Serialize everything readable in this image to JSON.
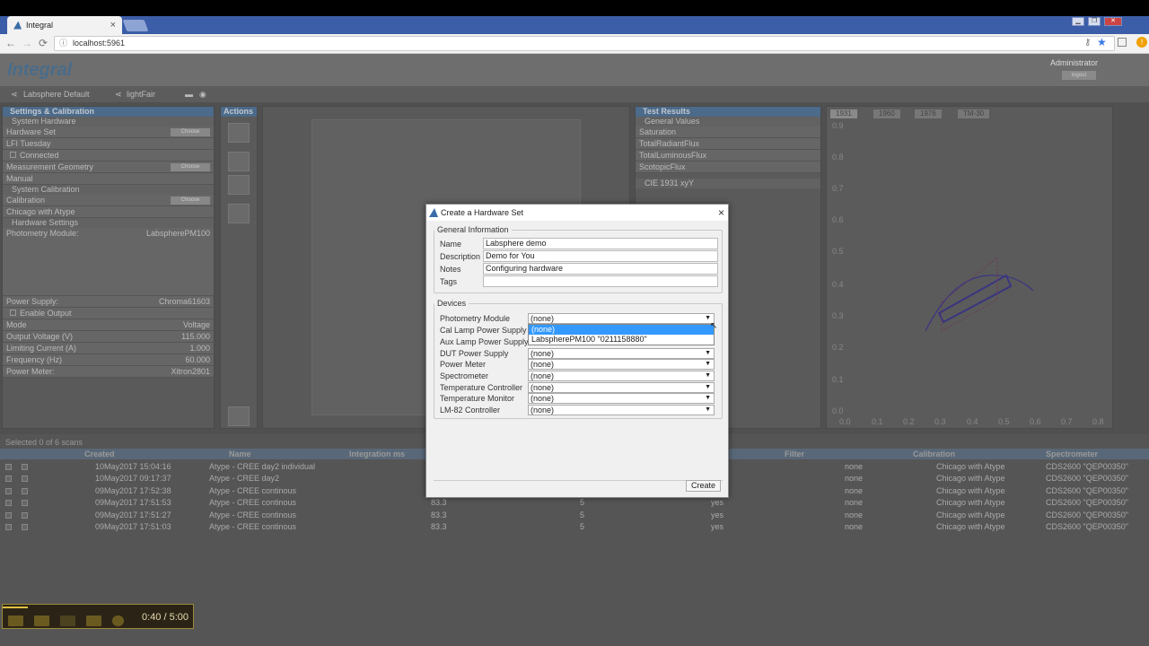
{
  "browser": {
    "tab_title": "Integral",
    "tab_close": "×",
    "url": "localhost:5961",
    "back_glyph": "←",
    "forward_glyph": "→",
    "reload_glyph": "⟳",
    "info_glyph": "ⓘ",
    "win_minimize": "▁",
    "win_restore": "❐",
    "win_close": "✕"
  },
  "app": {
    "logo": "Integral",
    "user": "Administrator",
    "logout": "logout"
  },
  "crumbs": {
    "profile": "Labsphere Default",
    "project": "lightFair"
  },
  "left": {
    "header": "Settings & Calibration",
    "system_hardware": "System Hardware",
    "hardware_set_label": "Hardware Set",
    "choose": "Choose",
    "hardware_set_value": "LFI Tuesday",
    "connected": "Connected",
    "measurement_geometry": "Measurement Geometry",
    "geometry_value": "Manual",
    "system_calibration": "System Calibration",
    "calibration_label": "Calibration",
    "calibration_value": "Chicago with Atype",
    "hardware_settings": "Hardware Settings",
    "photometry_module_label": "Photometry Module:",
    "photometry_module_value": "LabspherePM100",
    "power_supply_label": "Power Supply:",
    "power_supply_value": "Chroma61603",
    "enable_output": "Enable Output",
    "mode_label": "Mode",
    "mode_value": "Voltage",
    "output_voltage_label": "Output Voltage (V)",
    "output_voltage_value": "115.000",
    "limiting_current_label": "Limiting Current (A)",
    "limiting_current_value": "1.000",
    "frequency_label": "Frequency (Hz)",
    "frequency_value": "60.000",
    "power_meter_label": "Power Meter:",
    "power_meter_value": "Xitron2801"
  },
  "actions": {
    "header": "Actions"
  },
  "test_results": {
    "header": "Test Results",
    "general_values": "General Values",
    "items": [
      "Saturation",
      "TotalRadiantFlux",
      "TotalLuminousFlux",
      "ScotopicFlux"
    ],
    "cie": "CIE 1931 xyY"
  },
  "chart": {
    "tabs": [
      "1931",
      "1960",
      "1976",
      "TM-30"
    ],
    "yticks": [
      "0.9",
      "0.8",
      "0.7",
      "0.6",
      "0.5",
      "0.4",
      "0.3",
      "0.2",
      "0.1",
      "0.0"
    ],
    "xticks": [
      "0.0",
      "0.1",
      "0.2",
      "0.3",
      "0.4",
      "0.5",
      "0.6",
      "0.7",
      "0.8"
    ]
  },
  "table": {
    "selected": "Selected 0 of 6 scans",
    "headers": {
      "created": "Created",
      "name": "Name",
      "integration": "Integration ms",
      "filter": "Filter",
      "calibration": "Calibration",
      "spectrometer": "Spectrometer"
    },
    "rows": [
      {
        "created": "10May2017 15:04:16",
        "name": "Atype - CREE day2 individual",
        "int": "",
        "avg": "",
        "filt": "",
        "filter": "none",
        "cal": "Chicago with Atype",
        "spec": "CDS2600 \"QEP00350\""
      },
      {
        "created": "10May2017 09:17:37",
        "name": "Atype - CREE day2",
        "int": "",
        "avg": "",
        "filt": "",
        "filter": "none",
        "cal": "Chicago with Atype",
        "spec": "CDS2600 \"QEP00350\""
      },
      {
        "created": "09May2017 17:52:38",
        "name": "Atype - CREE continous",
        "int": "",
        "avg": "",
        "filt": "",
        "filter": "none",
        "cal": "Chicago with Atype",
        "spec": "CDS2600 \"QEP00350\""
      },
      {
        "created": "09May2017 17:51:53",
        "name": "Atype - CREE continous",
        "int": "83.3",
        "avg": "5",
        "filt": "yes",
        "filter": "none",
        "cal": "Chicago with Atype",
        "spec": "CDS2600 \"QEP00350\""
      },
      {
        "created": "09May2017 17:51:27",
        "name": "Atype - CREE continous",
        "int": "83.3",
        "avg": "5",
        "filt": "yes",
        "filter": "none",
        "cal": "Chicago with Atype",
        "spec": "CDS2600 \"QEP00350\""
      },
      {
        "created": "09May2017 17:51:03",
        "name": "Atype - CREE continous",
        "int": "83.3",
        "avg": "5",
        "filt": "yes",
        "filter": "none",
        "cal": "Chicago with Atype",
        "spec": "CDS2600 \"QEP00350\""
      }
    ]
  },
  "dialog": {
    "title": "Create a Hardware Set",
    "close": "×",
    "general_info": "General Information",
    "name_label": "Name",
    "name_value": "Labsphere demo",
    "description_label": "Description",
    "description_value": "Demo for You",
    "notes_label": "Notes",
    "notes_value": "Configuring hardware",
    "tags_label": "Tags",
    "tags_value": "",
    "devices": "Devices",
    "device_rows": [
      {
        "label": "Photometry Module",
        "value": "(none)"
      },
      {
        "label": "Cal Lamp Power Supply",
        "value": ""
      },
      {
        "label": "Aux Lamp Power Supply",
        "value": ""
      },
      {
        "label": "DUT Power Supply",
        "value": "(none)"
      },
      {
        "label": "Power Meter",
        "value": "(none)"
      },
      {
        "label": "Spectrometer",
        "value": "(none)"
      },
      {
        "label": "Temperature Controller",
        "value": "(none)"
      },
      {
        "label": "Temperature Monitor",
        "value": "(none)"
      },
      {
        "label": "LM-82 Controller",
        "value": "(none)"
      }
    ],
    "dropdown_options": [
      "(none)",
      "LabspherePM100 \"0211158880\""
    ],
    "create": "Create"
  },
  "player": {
    "time": "0:40 / 5:00",
    "progress": 0.133
  }
}
